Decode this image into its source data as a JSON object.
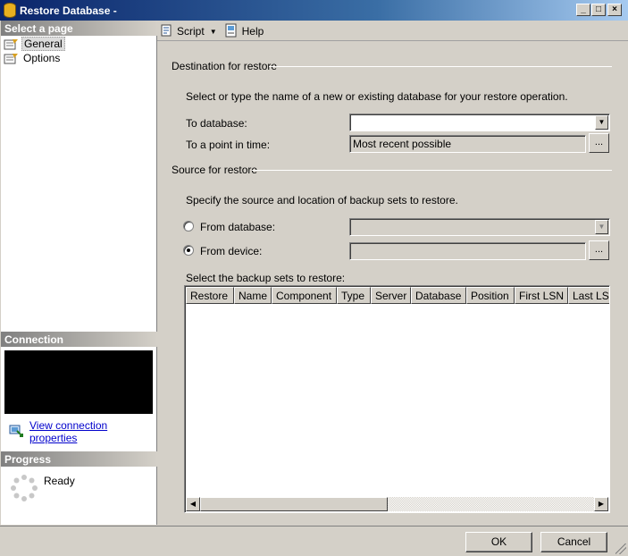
{
  "window": {
    "title": "Restore Database -",
    "controls": {
      "minimize": "_",
      "maximize": "□",
      "close": "×"
    }
  },
  "left": {
    "select_page_header": "Select a page",
    "pages": [
      {
        "label": "General",
        "icon": "page-icon",
        "selected": true
      },
      {
        "label": "Options",
        "icon": "page-icon",
        "selected": false
      }
    ],
    "connection_header": "Connection",
    "view_connection_link": "View connection properties",
    "progress_header": "Progress",
    "progress_status": "Ready"
  },
  "toolbar": {
    "script_label": "Script",
    "help_label": "Help"
  },
  "destination": {
    "group_label": "Destination for restore",
    "instruction": "Select or type the name of a new or existing database for your restore operation.",
    "to_database_label": "To database:",
    "to_database_value": "",
    "point_in_time_label": "To a point in time:",
    "point_in_time_value": "Most recent possible",
    "browse_label": "..."
  },
  "source": {
    "group_label": "Source for restore",
    "instruction": "Specify the source and location of backup sets to restore.",
    "from_database_label": "From database:",
    "from_database_value": "",
    "from_device_label": "From device:",
    "from_device_value": "",
    "selected_option": "From device",
    "browse_label": "...",
    "backup_sets_label": "Select the backup sets to restore:",
    "columns": [
      "Restore",
      "Name",
      "Component",
      "Type",
      "Server",
      "Database",
      "Position",
      "First LSN",
      "Last LSN"
    ]
  },
  "buttons": {
    "ok": "OK",
    "cancel": "Cancel"
  }
}
